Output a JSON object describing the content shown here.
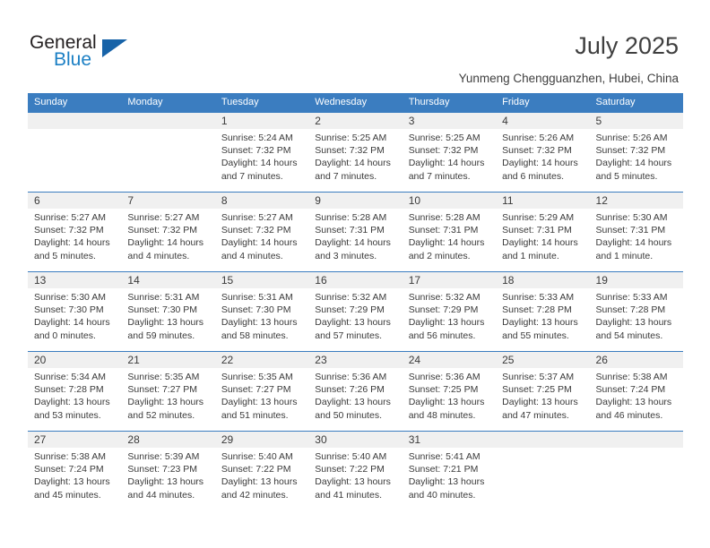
{
  "logo": {
    "word_one": "General",
    "word_two": "Blue",
    "triangle_color": "#1763a8",
    "blue_color": "#1b7fc4"
  },
  "header": {
    "title": "July 2025",
    "subtitle": "Yunmeng Chengguanzhen, Hubei, China"
  },
  "theme": {
    "header_blue": "#3b7dc0",
    "day_band_gray": "#f0f0f0",
    "text_color": "#3a3a3a"
  },
  "calendar": {
    "weekdays": [
      "Sunday",
      "Monday",
      "Tuesday",
      "Wednesday",
      "Thursday",
      "Friday",
      "Saturday"
    ],
    "weeks": [
      [
        {
          "day": "",
          "sunrise": "",
          "sunset": "",
          "daylight": ""
        },
        {
          "day": "",
          "sunrise": "",
          "sunset": "",
          "daylight": ""
        },
        {
          "day": "1",
          "sunrise": "Sunrise: 5:24 AM",
          "sunset": "Sunset: 7:32 PM",
          "daylight": "Daylight: 14 hours and 7 minutes."
        },
        {
          "day": "2",
          "sunrise": "Sunrise: 5:25 AM",
          "sunset": "Sunset: 7:32 PM",
          "daylight": "Daylight: 14 hours and 7 minutes."
        },
        {
          "day": "3",
          "sunrise": "Sunrise: 5:25 AM",
          "sunset": "Sunset: 7:32 PM",
          "daylight": "Daylight: 14 hours and 7 minutes."
        },
        {
          "day": "4",
          "sunrise": "Sunrise: 5:26 AM",
          "sunset": "Sunset: 7:32 PM",
          "daylight": "Daylight: 14 hours and 6 minutes."
        },
        {
          "day": "5",
          "sunrise": "Sunrise: 5:26 AM",
          "sunset": "Sunset: 7:32 PM",
          "daylight": "Daylight: 14 hours and 5 minutes."
        }
      ],
      [
        {
          "day": "6",
          "sunrise": "Sunrise: 5:27 AM",
          "sunset": "Sunset: 7:32 PM",
          "daylight": "Daylight: 14 hours and 5 minutes."
        },
        {
          "day": "7",
          "sunrise": "Sunrise: 5:27 AM",
          "sunset": "Sunset: 7:32 PM",
          "daylight": "Daylight: 14 hours and 4 minutes."
        },
        {
          "day": "8",
          "sunrise": "Sunrise: 5:27 AM",
          "sunset": "Sunset: 7:32 PM",
          "daylight": "Daylight: 14 hours and 4 minutes."
        },
        {
          "day": "9",
          "sunrise": "Sunrise: 5:28 AM",
          "sunset": "Sunset: 7:31 PM",
          "daylight": "Daylight: 14 hours and 3 minutes."
        },
        {
          "day": "10",
          "sunrise": "Sunrise: 5:28 AM",
          "sunset": "Sunset: 7:31 PM",
          "daylight": "Daylight: 14 hours and 2 minutes."
        },
        {
          "day": "11",
          "sunrise": "Sunrise: 5:29 AM",
          "sunset": "Sunset: 7:31 PM",
          "daylight": "Daylight: 14 hours and 1 minute."
        },
        {
          "day": "12",
          "sunrise": "Sunrise: 5:30 AM",
          "sunset": "Sunset: 7:31 PM",
          "daylight": "Daylight: 14 hours and 1 minute."
        }
      ],
      [
        {
          "day": "13",
          "sunrise": "Sunrise: 5:30 AM",
          "sunset": "Sunset: 7:30 PM",
          "daylight": "Daylight: 14 hours and 0 minutes."
        },
        {
          "day": "14",
          "sunrise": "Sunrise: 5:31 AM",
          "sunset": "Sunset: 7:30 PM",
          "daylight": "Daylight: 13 hours and 59 minutes."
        },
        {
          "day": "15",
          "sunrise": "Sunrise: 5:31 AM",
          "sunset": "Sunset: 7:30 PM",
          "daylight": "Daylight: 13 hours and 58 minutes."
        },
        {
          "day": "16",
          "sunrise": "Sunrise: 5:32 AM",
          "sunset": "Sunset: 7:29 PM",
          "daylight": "Daylight: 13 hours and 57 minutes."
        },
        {
          "day": "17",
          "sunrise": "Sunrise: 5:32 AM",
          "sunset": "Sunset: 7:29 PM",
          "daylight": "Daylight: 13 hours and 56 minutes."
        },
        {
          "day": "18",
          "sunrise": "Sunrise: 5:33 AM",
          "sunset": "Sunset: 7:28 PM",
          "daylight": "Daylight: 13 hours and 55 minutes."
        },
        {
          "day": "19",
          "sunrise": "Sunrise: 5:33 AM",
          "sunset": "Sunset: 7:28 PM",
          "daylight": "Daylight: 13 hours and 54 minutes."
        }
      ],
      [
        {
          "day": "20",
          "sunrise": "Sunrise: 5:34 AM",
          "sunset": "Sunset: 7:28 PM",
          "daylight": "Daylight: 13 hours and 53 minutes."
        },
        {
          "day": "21",
          "sunrise": "Sunrise: 5:35 AM",
          "sunset": "Sunset: 7:27 PM",
          "daylight": "Daylight: 13 hours and 52 minutes."
        },
        {
          "day": "22",
          "sunrise": "Sunrise: 5:35 AM",
          "sunset": "Sunset: 7:27 PM",
          "daylight": "Daylight: 13 hours and 51 minutes."
        },
        {
          "day": "23",
          "sunrise": "Sunrise: 5:36 AM",
          "sunset": "Sunset: 7:26 PM",
          "daylight": "Daylight: 13 hours and 50 minutes."
        },
        {
          "day": "24",
          "sunrise": "Sunrise: 5:36 AM",
          "sunset": "Sunset: 7:25 PM",
          "daylight": "Daylight: 13 hours and 48 minutes."
        },
        {
          "day": "25",
          "sunrise": "Sunrise: 5:37 AM",
          "sunset": "Sunset: 7:25 PM",
          "daylight": "Daylight: 13 hours and 47 minutes."
        },
        {
          "day": "26",
          "sunrise": "Sunrise: 5:38 AM",
          "sunset": "Sunset: 7:24 PM",
          "daylight": "Daylight: 13 hours and 46 minutes."
        }
      ],
      [
        {
          "day": "27",
          "sunrise": "Sunrise: 5:38 AM",
          "sunset": "Sunset: 7:24 PM",
          "daylight": "Daylight: 13 hours and 45 minutes."
        },
        {
          "day": "28",
          "sunrise": "Sunrise: 5:39 AM",
          "sunset": "Sunset: 7:23 PM",
          "daylight": "Daylight: 13 hours and 44 minutes."
        },
        {
          "day": "29",
          "sunrise": "Sunrise: 5:40 AM",
          "sunset": "Sunset: 7:22 PM",
          "daylight": "Daylight: 13 hours and 42 minutes."
        },
        {
          "day": "30",
          "sunrise": "Sunrise: 5:40 AM",
          "sunset": "Sunset: 7:22 PM",
          "daylight": "Daylight: 13 hours and 41 minutes."
        },
        {
          "day": "31",
          "sunrise": "Sunrise: 5:41 AM",
          "sunset": "Sunset: 7:21 PM",
          "daylight": "Daylight: 13 hours and 40 minutes."
        },
        {
          "day": "",
          "sunrise": "",
          "sunset": "",
          "daylight": ""
        },
        {
          "day": "",
          "sunrise": "",
          "sunset": "",
          "daylight": ""
        }
      ]
    ]
  }
}
